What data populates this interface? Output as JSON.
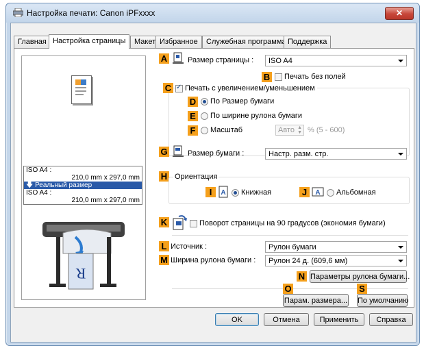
{
  "window": {
    "title": "Настройка печати: Canon iPFxxxx",
    "close": "✕"
  },
  "tabs": [
    "Главная",
    "Настройка страницы",
    "Макет",
    "Избранное",
    "Служебная программа",
    "Поддержка"
  ],
  "preview": {
    "rows": [
      "ISO A4 :",
      "210,0 mm x 297,0 mm",
      "Реальный размер",
      "ISO A4 :",
      "210,0 mm x 297,0 mm"
    ]
  },
  "markers": [
    "A",
    "B",
    "C",
    "D",
    "E",
    "F",
    "G",
    "H",
    "I",
    "J",
    "K",
    "L",
    "M",
    "N",
    "O",
    "S"
  ],
  "page_size": {
    "label": "Размер страницы :",
    "value": "ISO A4"
  },
  "borderless": {
    "label": "Печать без полей",
    "checked": false
  },
  "scaling": {
    "label": "Печать с увеличением/уменьшением",
    "checked": true,
    "options": [
      {
        "label": "По Размер бумаги",
        "selected": true
      },
      {
        "label": "По ширине рулона бумаги",
        "selected": false
      },
      {
        "label": "Масштаб",
        "selected": false
      }
    ],
    "scale_value": "Авто",
    "scale_range": "% (5 - 600)"
  },
  "paper_size": {
    "label": "Размер бумаги :",
    "value": "Настр. разм. стр."
  },
  "orientation": {
    "caption": "Ориентация",
    "portrait": {
      "label": "Книжная",
      "selected": true
    },
    "landscape": {
      "label": "Альбомная",
      "selected": false
    }
  },
  "rotate": {
    "label": "Поворот страницы на 90 градусов (экономия бумаги)",
    "checked": false
  },
  "source": {
    "label": "Источник :",
    "value": "Рулон бумаги"
  },
  "roll_width": {
    "label": "Ширина рулона бумаги :",
    "value": "Рулон 24 д. (609,6 мм)"
  },
  "buttons": {
    "roll_params": "Параметры рулона бумаги...",
    "size_params": "Парам. размера...",
    "defaults": "По умолчанию",
    "ok": "OK",
    "cancel": "Отмена",
    "apply": "Применить",
    "help": "Справка"
  }
}
